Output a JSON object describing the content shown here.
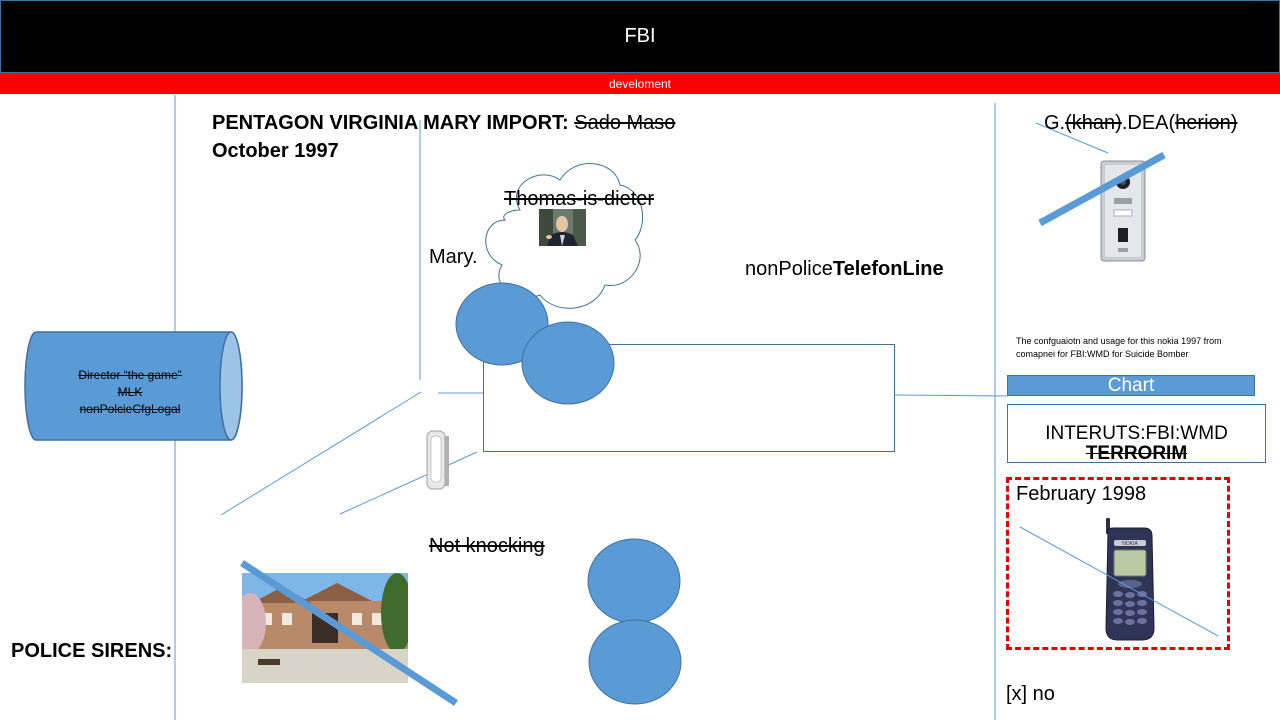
{
  "header": {
    "title": "FBI",
    "subtitle": "develoment"
  },
  "main": {
    "headline_prefix": "PENTAGON VIRGINIA MARY IMPORT:",
    "headline_struck": "Sado Maso",
    "date": "October 1997",
    "cloud_text": "Thomas-is-dieter",
    "mary_label": "Mary.",
    "telefon_label_normal": "nonPolice",
    "telefon_label_bold": "TelefonLine",
    "not_knocking": "Not knocking",
    "police_sirens": "POLICE SIRENS:"
  },
  "cylinder": {
    "line1": "Director “the game”",
    "line2": "MLK",
    "line3": "nonPolcieCfgLogal"
  },
  "right": {
    "label_g": "G.",
    "label_khan": "(khan)",
    "label_dea": ".DEA(",
    "label_herion": "herion)",
    "description_line1": "The confguaiotn and usage for this nokia 1997 from",
    "description_line2": "comapnei for FBI:WMD for Suicide Bomber",
    "chart_label": "Chart",
    "interuts_line": "INTERUTS:FBI:WMD",
    "terrorim": "TERRORIM",
    "february": "February 1998",
    "phone_brand": "NOKIA",
    "checkbox_text": "[x] no"
  },
  "colors": {
    "shape_blue": "#5b9bd5",
    "shape_border": "#41719c",
    "header_black": "#000000",
    "sub_red": "#ff0000",
    "dash_red": "#e00000"
  }
}
